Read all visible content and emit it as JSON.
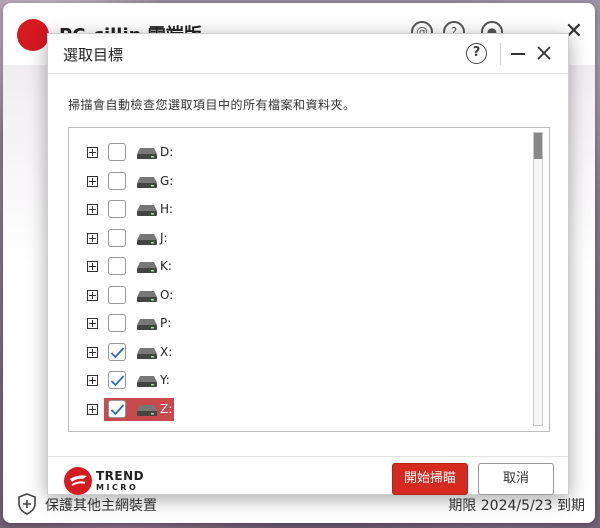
{
  "app": {
    "title": "PC-cillin 雲端版",
    "footer_left": "保護其他主網裝置",
    "footer_right": "期限 2024/5/23 到期"
  },
  "dialog": {
    "title": "選取目標",
    "description": "掃描會自動檢查您選取項目中的所有檔案和資料夾。",
    "drives": [
      {
        "label": "D:",
        "checked": false
      },
      {
        "label": "G:",
        "checked": false
      },
      {
        "label": "H:",
        "checked": false
      },
      {
        "label": "J:",
        "checked": false
      },
      {
        "label": "K:",
        "checked": false
      },
      {
        "label": "O:",
        "checked": false
      },
      {
        "label": "P:",
        "checked": false
      },
      {
        "label": "X:",
        "checked": true
      },
      {
        "label": "Y:",
        "checked": true
      },
      {
        "label": "Z:",
        "checked": true,
        "selected": true
      }
    ],
    "brand_top": "TREND",
    "brand_bottom": "MICRO",
    "start_label": "開始掃瞄",
    "cancel_label": "取消"
  },
  "colors": {
    "accent": "#d42a20",
    "selection": "#c94a4c",
    "check": "#2a6fb0"
  }
}
